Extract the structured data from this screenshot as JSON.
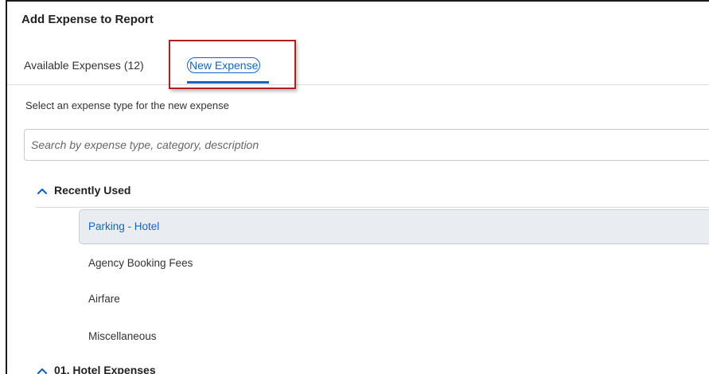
{
  "dialog": {
    "title": "Add Expense to Report"
  },
  "tabs": [
    {
      "label": "Available Expenses (12)",
      "active": false
    },
    {
      "label": "New Expense",
      "active": true
    }
  ],
  "instruction": "Select an expense type for the new expense",
  "search": {
    "placeholder": "Search by expense type, category, description",
    "value": ""
  },
  "sections": [
    {
      "title": "Recently Used",
      "expanded": true,
      "items": [
        {
          "label": "Parking - Hotel",
          "selected": true
        },
        {
          "label": "Agency Booking Fees",
          "selected": false
        },
        {
          "label": "Airfare",
          "selected": false
        },
        {
          "label": "Miscellaneous",
          "selected": false
        }
      ]
    },
    {
      "title": "01. Hotel Expenses",
      "expanded": true,
      "items": []
    }
  ],
  "colors": {
    "accent": "#1565c0",
    "highlight_border": "#b21e1e",
    "selected_bg": "#e9ecf1"
  }
}
